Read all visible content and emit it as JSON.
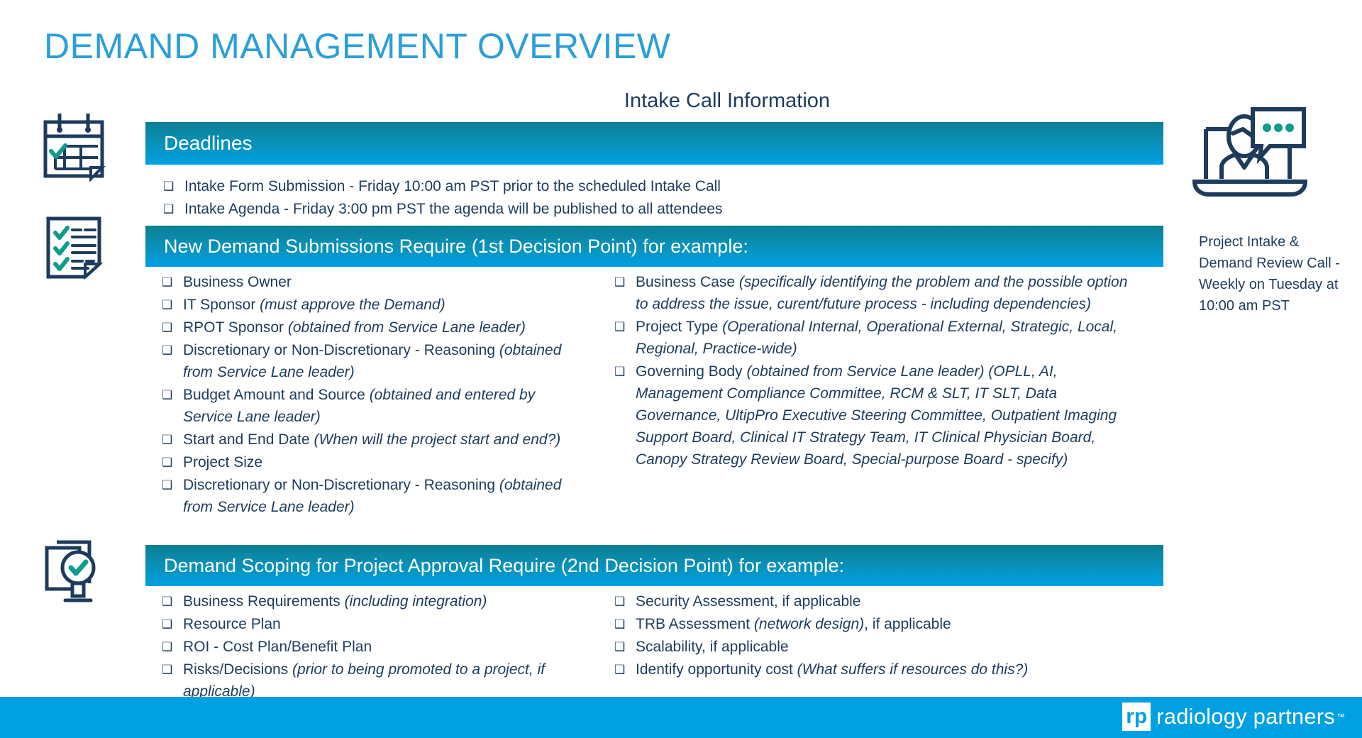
{
  "title": "DEMAND MANAGEMENT OVERVIEW",
  "subtitle": "Intake Call Information",
  "colors": {
    "title_blue": "#2a9fd8",
    "bar_gradient_top": "#0a7f93",
    "bar_gradient_bottom": "#00a0e3",
    "body_navy": "#1d3b5c",
    "footer_blue": "#00a0e3",
    "icon_accent_teal": "#0f9b8e"
  },
  "sections": [
    {
      "id": "deadlines",
      "heading": "Deadlines",
      "icon": "calendar-check-icon",
      "left_items": [
        {
          "text": "Intake Form Submission - Friday 10:00 am PST prior to the scheduled Intake Call",
          "italic": ""
        },
        {
          "text": "Intake Agenda - Friday 3:00 pm PST the agenda will be published to all attendees",
          "italic": ""
        }
      ],
      "right_items": []
    },
    {
      "id": "new-demand",
      "heading": "New Demand Submissions Require (1st Decision Point) for example:",
      "icon": "checklist-document-icon",
      "left_items": [
        {
          "text": "Business Owner",
          "italic": ""
        },
        {
          "text": "IT Sponsor ",
          "italic": "(must approve the Demand)"
        },
        {
          "text": "RPOT Sponsor ",
          "italic": "(obtained from Service Lane leader)"
        },
        {
          "text": "Discretionary or Non-Discretionary - Reasoning ",
          "italic": "(obtained from Service Lane leader)"
        },
        {
          "text": "Budget Amount and Source ",
          "italic": "(obtained and entered by Service Lane leader)"
        },
        {
          "text": "Start and End Date ",
          "italic": "(When will the project start and end?)"
        },
        {
          "text": "Project Size",
          "italic": ""
        },
        {
          "text": "Discretionary or Non-Discretionary - Reasoning ",
          "italic": "(obtained from Service Lane leader)"
        }
      ],
      "right_items": [
        {
          "text": "Business Case ",
          "italic": "(specifically identifying the problem and the possible option to address the issue, curent/future process - including dependencies)"
        },
        {
          "text": "Project Type ",
          "italic": "(Operational Internal, Operational External, Strategic, Local, Regional, Practice-wide)"
        },
        {
          "text": "Governing Body ",
          "italic": "(obtained from Service Lane leader) (OPLL, AI, Management Compliance Committee, RCM & SLT, IT SLT, Data Governance, UltipPro Executive Steering Committee, Outpatient Imaging Support Board, Clinical IT Strategy Team, IT Clinical Physician Board, Canopy Strategy Review Board, Special-purpose Board - specify)"
        }
      ]
    },
    {
      "id": "scoping",
      "heading": "Demand Scoping for Project Approval Require (2nd Decision Point) for example:",
      "icon": "approval-stamp-icon",
      "left_items": [
        {
          "text": "Business Requirements ",
          "italic": "(including integration)"
        },
        {
          "text": "Resource Plan",
          "italic": ""
        },
        {
          "text": "ROI - Cost Plan/Benefit Plan",
          "italic": ""
        },
        {
          "text": "Risks/Decisions ",
          "italic": "(prior to being promoted to a project, if applicable)"
        }
      ],
      "right_items": [
        {
          "text": "Security Assessment, if applicable",
          "italic": ""
        },
        {
          "text": "TRB Assessment ",
          "italic": "(network design)",
          "suffix": ", if applicable"
        },
        {
          "text": "Scalability, if applicable",
          "italic": ""
        },
        {
          "text": "Identify opportunity cost ",
          "italic": "(What suffers if resources do this?)"
        }
      ]
    }
  ],
  "sidebar": {
    "icon": "video-call-person-icon",
    "note": "Project Intake & Demand Review Call - Weekly on Tuesday at 10:00 am PST"
  },
  "footer": {
    "logo_mark": "rp",
    "logo_text": "radiology partners",
    "trademark": "™"
  },
  "bullet_glyph": "❑"
}
